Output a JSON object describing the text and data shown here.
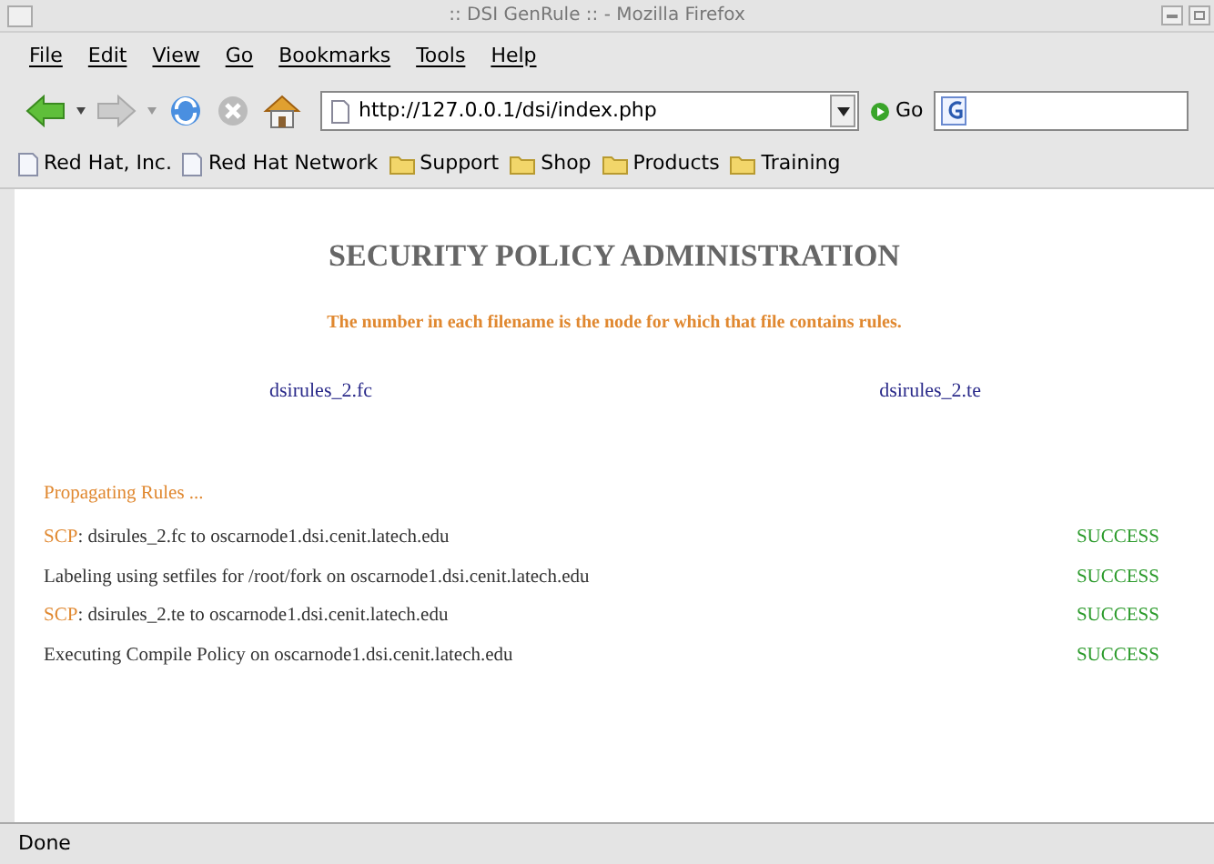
{
  "window": {
    "title": ":: DSI GenRule :: - Mozilla Firefox"
  },
  "menu": [
    "File",
    "Edit",
    "View",
    "Go",
    "Bookmarks",
    "Tools",
    "Help"
  ],
  "navigation": {
    "url": "http://127.0.0.1/dsi/index.php",
    "go": "Go"
  },
  "bookmarks": [
    {
      "label": "Red Hat, Inc.",
      "kind": "page"
    },
    {
      "label": "Red Hat Network",
      "kind": "page"
    },
    {
      "label": "Support",
      "kind": "folder"
    },
    {
      "label": "Shop",
      "kind": "folder"
    },
    {
      "label": "Products",
      "kind": "folder"
    },
    {
      "label": "Training",
      "kind": "folder"
    }
  ],
  "page": {
    "heading": "SECURITY POLICY ADMINISTRATION",
    "note": "The number in each filename is the node for which that file contains rules.",
    "files": [
      "dsirules_2.fc",
      "dsirules_2.te"
    ],
    "log_title": "Propagating Rules ...",
    "log": [
      {
        "prefix": "SCP",
        "text": ": dsirules_2.fc to oscarnode1.dsi.cenit.latech.edu",
        "status": "SUCCESS"
      },
      {
        "text": "Labeling using setfiles for /root/fork on oscarnode1.dsi.cenit.latech.edu",
        "status": "SUCCESS"
      },
      {
        "prefix": "SCP",
        "text": ": dsirules_2.te to oscarnode1.dsi.cenit.latech.edu",
        "status": "SUCCESS"
      },
      {
        "text": "Executing Compile Policy on oscarnode1.dsi.cenit.latech.edu",
        "status": "SUCCESS"
      }
    ]
  },
  "status_bar": "Done"
}
